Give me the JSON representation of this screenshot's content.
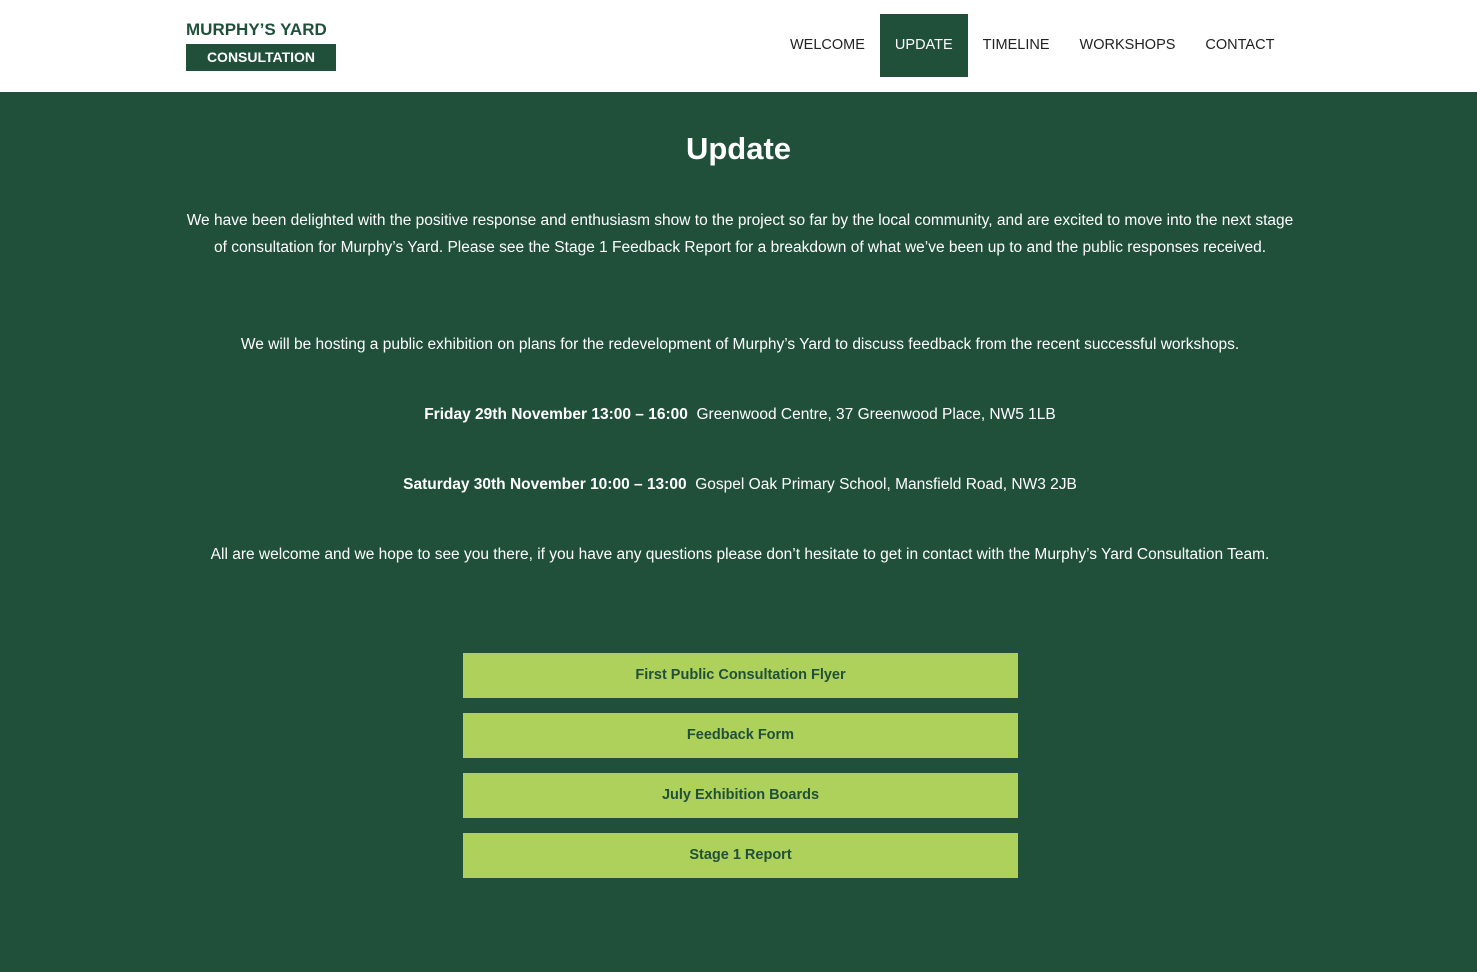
{
  "header": {
    "logo_top": "MURPHY’S YARD",
    "logo_bottom": "CONSULTATION",
    "nav": [
      {
        "label": "WELCOME"
      },
      {
        "label": "UPDATE",
        "active": true
      },
      {
        "label": "TIMELINE"
      },
      {
        "label": "WORKSHOPS"
      },
      {
        "label": "CONTACT"
      }
    ]
  },
  "main": {
    "title": "Update",
    "paragraph1": "We have been delighted with the positive response and enthusiasm show to the project so far by the local community, and are excited to move into the next stage of consultation for Murphy’s Yard. Please see the Stage 1 Feedback Report for a breakdown of what we’ve been up to and the public responses received.",
    "paragraph2": "We will be hosting a public exhibition on plans for the redevelopment of Murphy’s Yard to discuss feedback from the recent successful workshops.",
    "event1": {
      "when": "Friday 29th November 13:00 – 16:00",
      "where": "Greenwood Centre, 37 Greenwood Place, NW5 1LB"
    },
    "event2": {
      "when": "Saturday 30th November 10:00 – 13:00",
      "where": "Gospel Oak Primary School, Mansfield Road, NW3 2JB"
    },
    "paragraph3": "All are welcome and we hope to see you there, if you have any questions please don’t hesitate to get in contact with the Murphy’s Yard Consultation Team.",
    "buttons": [
      {
        "label": "First Public Consultation Flyer"
      },
      {
        "label": "Feedback Form"
      },
      {
        "label": "July Exhibition Boards"
      },
      {
        "label": "Stage 1 Report"
      }
    ]
  },
  "colors": {
    "brand_green": "#20503a",
    "button_green": "#add15a",
    "header_bg": "#ffffff"
  }
}
